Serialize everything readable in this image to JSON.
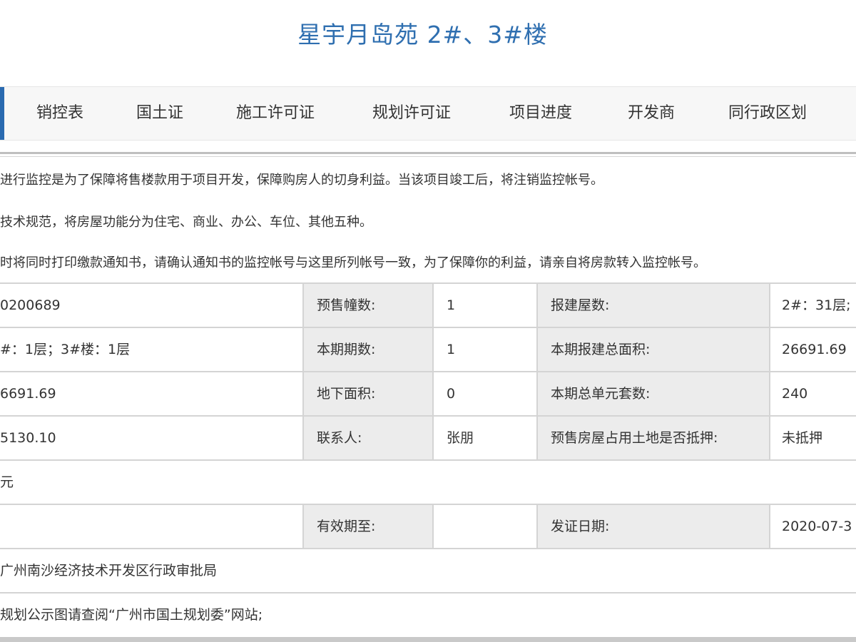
{
  "page": {
    "title": "星宇月岛苑 2#、3#楼"
  },
  "tabs": [
    {
      "label": "销控表"
    },
    {
      "label": "国土证"
    },
    {
      "label": "施工许可证"
    },
    {
      "label": "规划许可证"
    },
    {
      "label": "项目进度"
    },
    {
      "label": "开发商"
    },
    {
      "label": "同行政区划"
    }
  ],
  "notes": [
    "进行监控是为了保障将售楼款用于项目开发，保障购房人的切身利益。当该项目竣工后，将注销监控帐号。",
    "技术规范，将房屋功能分为住宅、商业、办公、车位、其他五种。",
    "时将同时打印缴款通知书，请确认通知书的监控帐号与这里所列帐号一致，为了保障你的利益，请亲自将房款转入监控帐号。"
  ],
  "table": {
    "rows": [
      {
        "v1": "0200689",
        "l2": "预售幢数:",
        "v2": "1",
        "l3": "报建屋数:",
        "v3": "2#：31层;"
      },
      {
        "v1": "#：1层；3#楼：1层",
        "l2": "本期期数:",
        "v2": "1",
        "l3": "本期报建总面积:",
        "v3": "26691.69"
      },
      {
        "v1": "6691.69",
        "l2": "地下面积:",
        "v2": "0",
        "l3": "本期总单元套数:",
        "v3": "240"
      },
      {
        "v1": "5130.10",
        "l2": "联系人:",
        "v2": "张朋",
        "l3": "预售房屋占用土地是否抵押:",
        "v3": "未抵押"
      }
    ],
    "unit_row": "元",
    "validity_row": {
      "v1": "",
      "l2": "有效期至:",
      "v2": "",
      "l3": "发证日期:",
      "v3": "2020-07-3"
    },
    "authority": "广州南沙经济技术开发区行政审批局",
    "planning_note": "规划公示图请查阅“广州市国土规划委”网站;"
  }
}
